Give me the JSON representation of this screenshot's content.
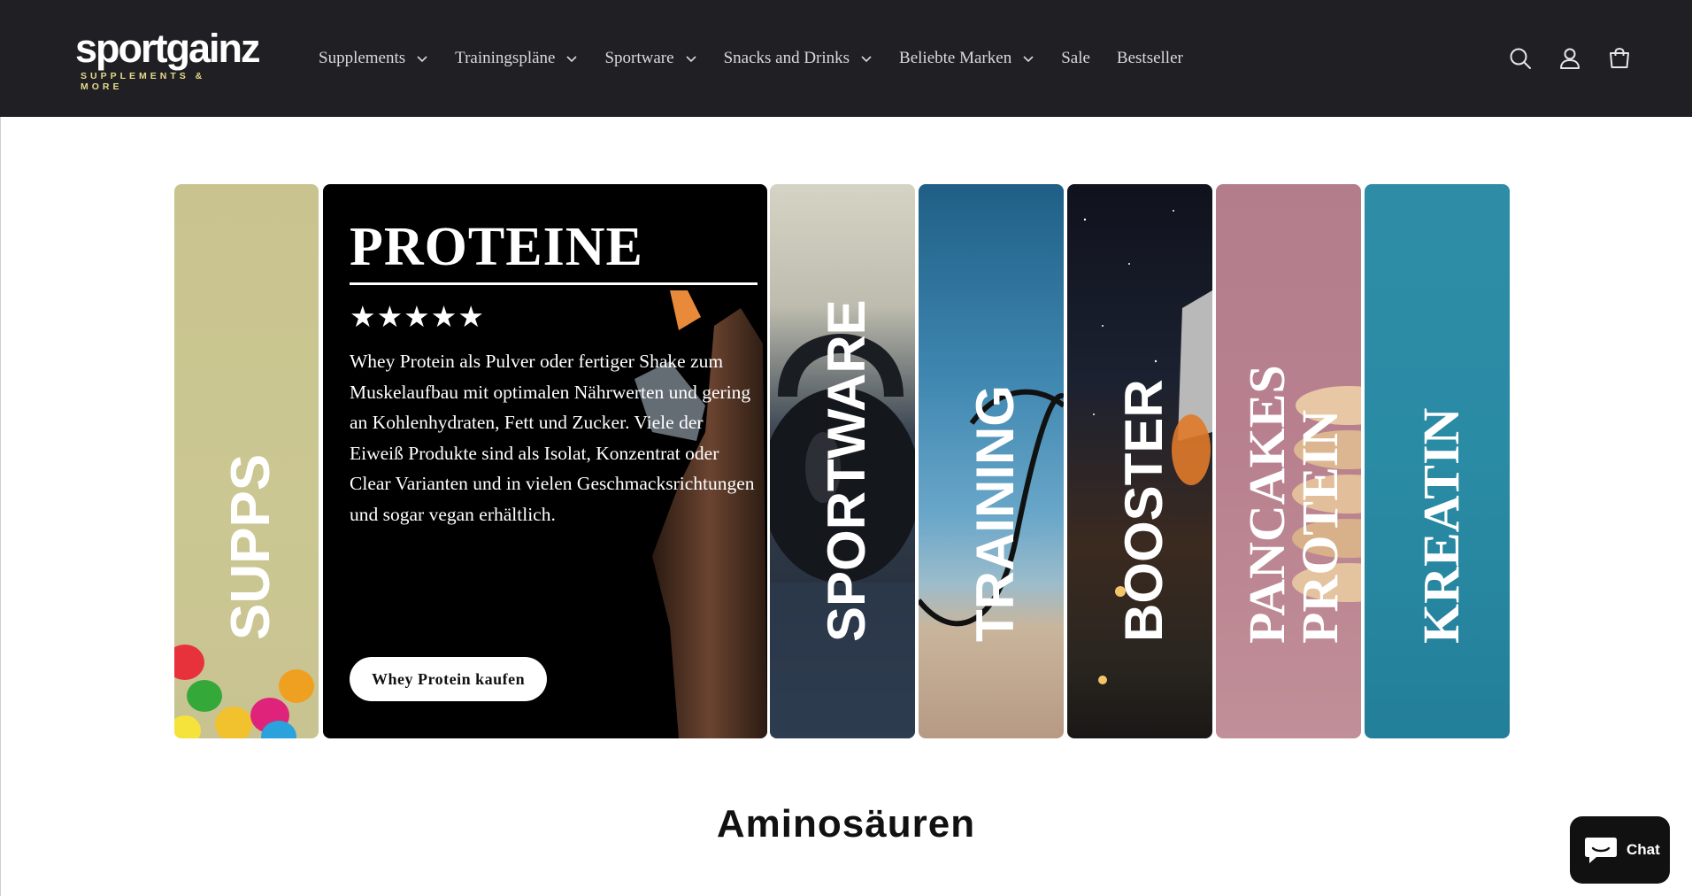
{
  "header": {
    "logo_word": "sportgainz",
    "logo_tagline": "SUPPLEMENTS & MORE",
    "nav": [
      {
        "label": "Supplements",
        "has_dropdown": true
      },
      {
        "label": "Trainingspläne",
        "has_dropdown": true
      },
      {
        "label": "Sportware",
        "has_dropdown": true
      },
      {
        "label": "Snacks and Drinks",
        "has_dropdown": true
      },
      {
        "label": "Beliebte Marken",
        "has_dropdown": true
      },
      {
        "label": "Sale",
        "has_dropdown": false
      },
      {
        "label": "Bestseller",
        "has_dropdown": false
      }
    ],
    "icons": [
      "search-icon",
      "account-icon",
      "cart-icon"
    ]
  },
  "banner": {
    "panels": {
      "supps": {
        "label": "SUPPS"
      },
      "proteine": {
        "title": "PROTEINE",
        "rating": "★★★★★",
        "description": "Whey Protein als Pulver oder fertiger Shake zum Muskelaufbau mit optimalen Nährwerten und gering an Kohlenhydraten, Fett und Zucker. Viele der Eiweiß Produkte sind als Isolat, Konzentrat oder Clear Varianten und in vielen Geschmacksrichtungen und sogar vegan erhältlich.",
        "button": "Whey Protein kaufen"
      },
      "sportware": {
        "label": "SPORTWARE"
      },
      "training": {
        "label": "TRAINING"
      },
      "booster": {
        "label": "BOOSTER"
      },
      "pancakes": {
        "line1": "PANCAKES",
        "line2": "PROTEIN"
      },
      "kreatin": {
        "label": "KREATIN"
      }
    }
  },
  "section": {
    "title": "Aminosäuren"
  },
  "chat": {
    "label": "Chat"
  },
  "colors": {
    "header_bg": "#202024",
    "supps": "#c9c48f",
    "pancakes": "#b37d8c",
    "kreatin": "#2a8ba5",
    "accent_tagline": "#e8d98c"
  }
}
